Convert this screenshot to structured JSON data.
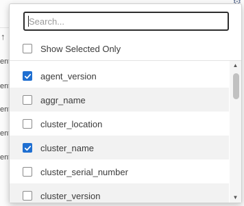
{
  "search": {
    "placeholder": "Search..."
  },
  "show_selected": {
    "label": "Show Selected Only",
    "checked": false
  },
  "columns": [
    {
      "label": "agent_version",
      "checked": true
    },
    {
      "label": "aggr_name",
      "checked": false
    },
    {
      "label": "cluster_location",
      "checked": false
    },
    {
      "label": "cluster_name",
      "checked": true
    },
    {
      "label": "cluster_serial_number",
      "checked": false
    },
    {
      "label": "cluster_version",
      "checked": false
    }
  ],
  "background": {
    "cell_text": "ent",
    "sort_icon": "arrow-up-icon",
    "settings_icon": "gear-icon"
  },
  "colors": {
    "check_fill": "#1f6fd1"
  }
}
